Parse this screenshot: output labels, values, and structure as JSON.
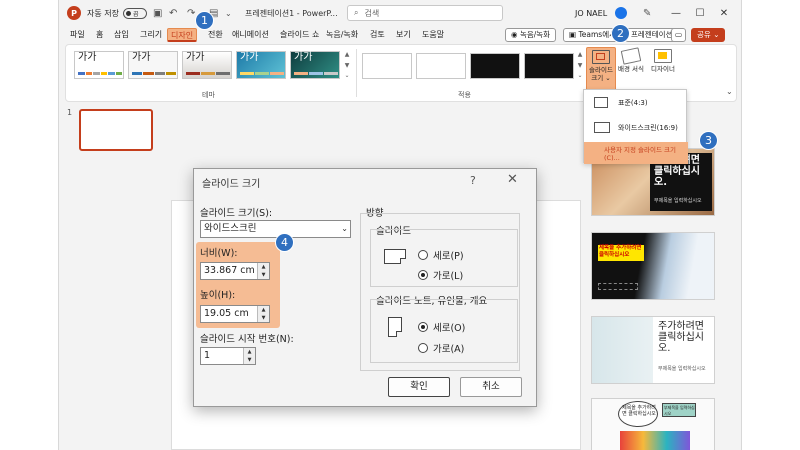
{
  "titlebar": {
    "logo": "P",
    "autosave_label": "자동 저장",
    "autosave_state": "끔",
    "document_title": "프레젠테이션1 - PowerP...",
    "search_placeholder": "검색",
    "user_name": "JO NAEL"
  },
  "tabs": [
    {
      "label": "파일"
    },
    {
      "label": "홈"
    },
    {
      "label": "삽입"
    },
    {
      "label": "그리기"
    },
    {
      "label": "디자인"
    },
    {
      "label": "전환"
    },
    {
      "label": "애니메이션"
    },
    {
      "label": "슬라이드 쇼"
    },
    {
      "label": "녹음/녹화"
    },
    {
      "label": "검토"
    },
    {
      "label": "보기"
    },
    {
      "label": "도움말"
    }
  ],
  "tab_actions": {
    "record_label": "녹음/녹화",
    "teams_label": "Teams에서",
    "present_label": "프레젠테이션",
    "share_label": "공유"
  },
  "ribbon": {
    "theme_sample_text": "가가",
    "themes_group_label": "테마",
    "variants_group_label": "적용",
    "slide_size_label": "슬라이드 크기",
    "format_bg_label": "배경 서식",
    "designer_label": "디자이너"
  },
  "slide_size_menu": {
    "standard": "표준(4:3)",
    "widescreen": "와이드스크린(16:9)",
    "custom": "사용자 지정 슬라이드 크기(C)..."
  },
  "thumbnails": {
    "slide_number": "1"
  },
  "design_ideas": [
    {
      "title": "주가하려면 클릭하십시오.",
      "subtitle": "부제목을 입력하십시오"
    },
    {
      "title": "제목을 추가하려면 클릭하십시오",
      "subtitle": ""
    },
    {
      "title": "주가하려면 클릭하십시오.",
      "subtitle": "부제목을 입력하십시오"
    },
    {
      "title": "제목을 추가하려면 클릭하십시오",
      "subtitle": "부제목을 입력하십시오"
    }
  ],
  "dialog": {
    "title": "슬라이드 크기",
    "help": "?",
    "close": "✕",
    "size_label": "슬라이드 크기(S):",
    "size_value": "와이드스크린",
    "width_label": "너비(W):",
    "width_value": "33.867 cm",
    "height_label": "높이(H):",
    "height_value": "19.05 cm",
    "start_num_label": "슬라이드 시작 번호(N):",
    "start_num_value": "1",
    "orientation_label": "방향",
    "slides_label": "슬라이드",
    "slides_portrait": "세로(P)",
    "slides_landscape": "가로(L)",
    "notes_label": "슬라이드 노트, 유인물, 개요",
    "notes_portrait": "세로(O)",
    "notes_landscape": "가로(A)",
    "ok": "확인",
    "cancel": "취소"
  },
  "badges": [
    "1",
    "2",
    "3",
    "4"
  ],
  "colors": {
    "accent": "#c43e1c",
    "highlight": "#f4b183",
    "badge": "#2f6fbf"
  }
}
